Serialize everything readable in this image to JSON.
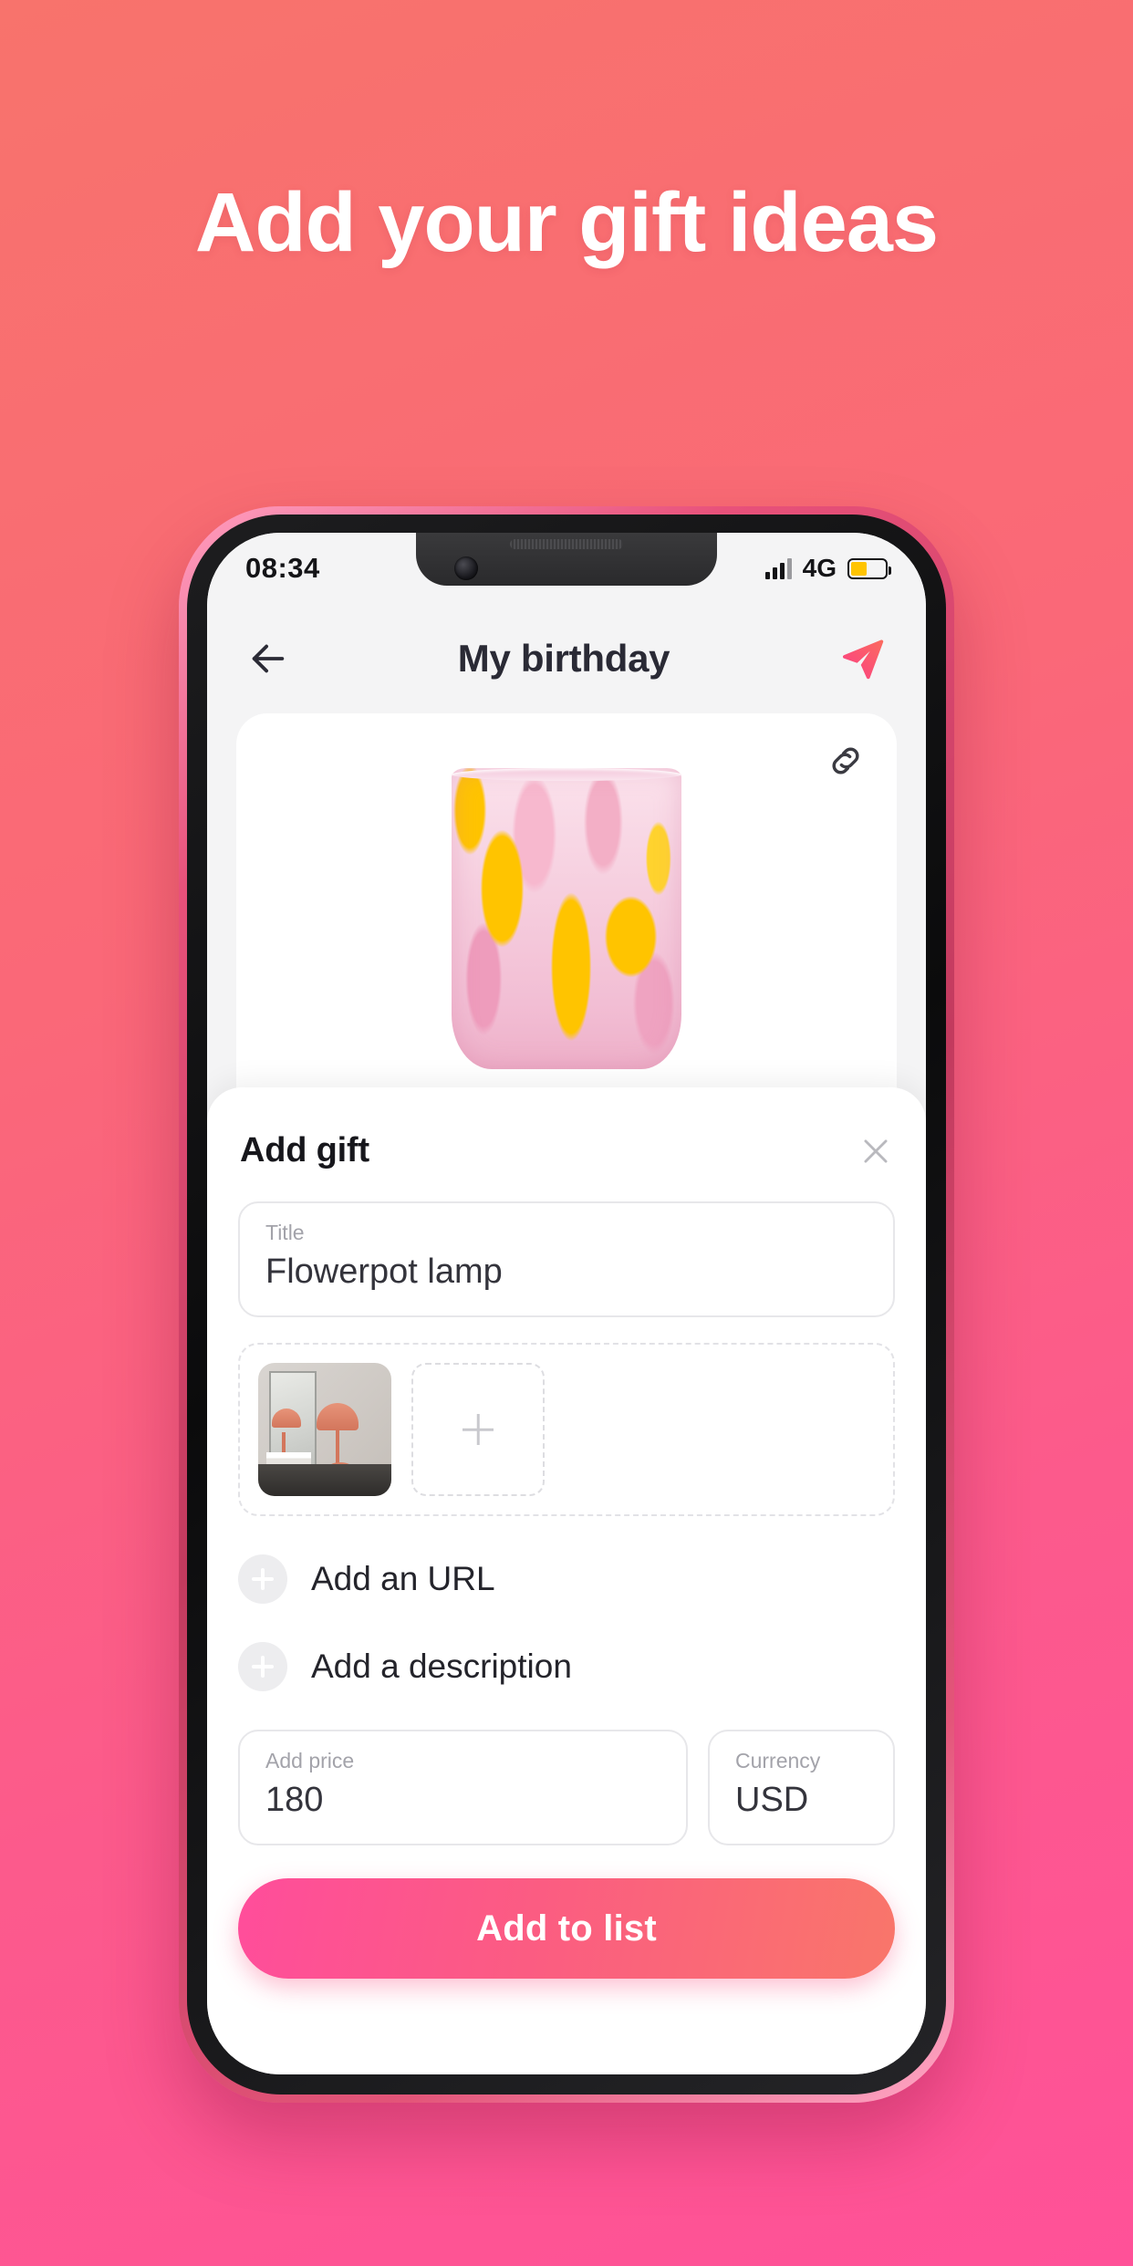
{
  "promo": {
    "headline": "Add your gift ideas",
    "background_top_color": "#F8736C",
    "background_bottom_color": "#FF5198"
  },
  "statusbar": {
    "time": "08:34",
    "network": "4G",
    "signal_icon": "signal-bars-icon",
    "battery_icon": "battery-icon",
    "battery_color": "#FFC400"
  },
  "appbar": {
    "back_icon": "back-arrow-icon",
    "title": "My birthday",
    "share_icon": "send-plane-icon",
    "share_color": "#FB4E78"
  },
  "product": {
    "link_icon": "link-chain-icon",
    "image_alt": "pink and yellow speckled glass tumbler"
  },
  "sheet": {
    "title": "Add gift",
    "close_icon": "close-x-icon",
    "title_field": {
      "label": "Title",
      "value": "Flowerpot lamp"
    },
    "photos": {
      "thumbnail_alt": "flowerpot table lamps beside mirror",
      "add_photo_icon": "plus-icon"
    },
    "add_rows": [
      {
        "icon": "plus-circle-icon",
        "label": "Add an URL"
      },
      {
        "icon": "plus-circle-icon",
        "label": "Add a description"
      }
    ],
    "price_field": {
      "label": "Add price",
      "value": "180"
    },
    "currency_field": {
      "label": "Currency",
      "value": "USD"
    },
    "cta_label": "Add to list"
  }
}
